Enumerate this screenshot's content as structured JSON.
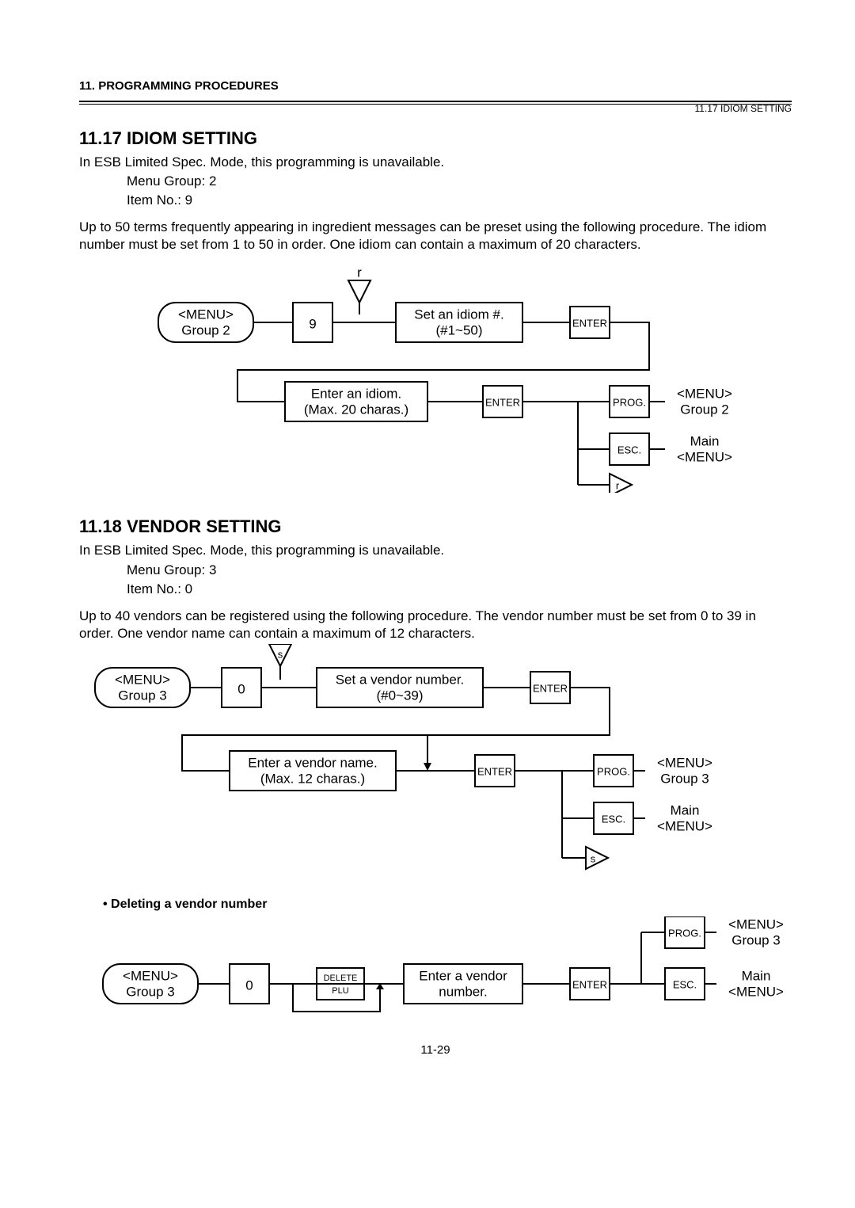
{
  "header": {
    "left": "11. PROGRAMMING PROCEDURES",
    "right": "11.17 IDIOM SETTING"
  },
  "s17": {
    "title": "11.17 IDIOM SETTING",
    "p1": "In ESB Limited Spec. Mode, this programming is unavailable.",
    "mg": "Menu Group:   2",
    "it": "Item No.: 9",
    "p2": "Up to 50 terms frequently appearing in ingredient messages can be preset using the following procedure. The idiom number must be set from 1 to 50 in order.  One idiom can contain a maximum of 20 characters.",
    "fc": {
      "menuStart1": "<MENU>",
      "menuStart2": "Group 2",
      "key": "9",
      "setIdiom1": "Set an idiom #.",
      "setIdiom2": "(#1~50)",
      "enter": "ENTER",
      "enterIdiom1": "Enter  an idiom.",
      "enterIdiom2": "(Max. 20 charas.)",
      "prog": "PROG.",
      "endMenu1": "<MENU>",
      "endMenu2": "Group 2",
      "esc": "ESC.",
      "mainMenu1": "Main",
      "mainMenu2": "<MENU>",
      "loop": "r"
    }
  },
  "s18": {
    "title": "11.18 VENDOR SETTING",
    "p1": "In ESB Limited Spec. Mode, this programming is unavailable.",
    "mg": "Menu Group:   3",
    "it": "Item No.: 0",
    "p2": "Up to 40 vendors can be registered using the following procedure.  The vendor number must be set from 0 to 39 in order.  One vendor name can contain a maximum of 12 characters.",
    "fc": {
      "menuStart1": "<MENU>",
      "menuStart2": "Group 3",
      "key": "0",
      "setNum1": "Set a vendor number.",
      "setNum2": "(#0~39)",
      "enter": "ENTER",
      "enterName1": "Enter  a vendor name.",
      "enterName2": "(Max. 12 charas.)",
      "prog": "PROG.",
      "endMenu1": "<MENU>",
      "endMenu2": "Group 3",
      "esc": "ESC.",
      "mainMenu1": "Main",
      "mainMenu2": "<MENU>",
      "loop": "s"
    },
    "del": {
      "heading": "• Deleting a vendor number",
      "menuStart1": "<MENU>",
      "menuStart2": "Group 3",
      "key": "0",
      "deleteTop": "DELETE",
      "deleteBot": "PLU",
      "enterNum1": "Enter a vendor",
      "enterNum2": "number.",
      "enter": "ENTER",
      "esc": "ESC.",
      "prog": "PROG.",
      "endMenuA1": "<MENU>",
      "endMenuA2": "Group 3",
      "endMenuB1": "Main",
      "endMenuB2": "<MENU>"
    }
  },
  "pagenum": "11-29"
}
